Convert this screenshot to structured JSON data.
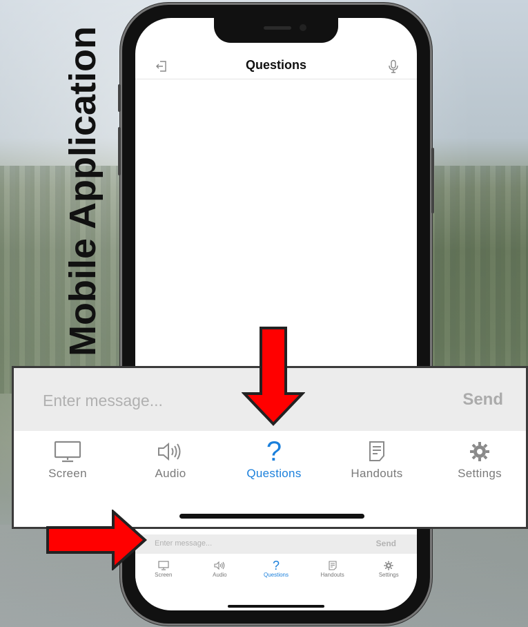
{
  "side_title": "Mobile Application",
  "header": {
    "title": "Questions",
    "exit_icon": "exit-icon",
    "mic_icon": "microphone-icon"
  },
  "composer": {
    "placeholder": "Enter message...",
    "send_label": "Send"
  },
  "tabs": [
    {
      "label": "Screen",
      "icon": "monitor-icon",
      "active": false
    },
    {
      "label": "Audio",
      "icon": "speaker-icon",
      "active": false
    },
    {
      "label": "Questions",
      "icon": "question-mark-icon",
      "active": true
    },
    {
      "label": "Handouts",
      "icon": "document-icon",
      "active": false
    },
    {
      "label": "Settings",
      "icon": "gear-icon",
      "active": false
    }
  ],
  "colors": {
    "accent": "#1a7fdb",
    "arrow": "#ff0000",
    "inactive": "#7a7a7a"
  }
}
